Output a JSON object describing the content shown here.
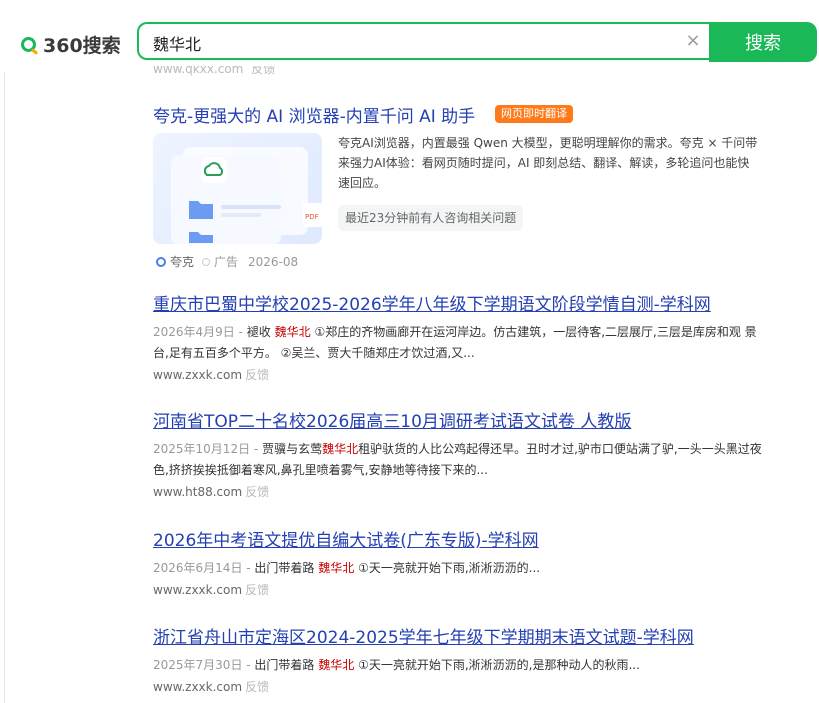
{
  "header": {
    "logo_text": "360搜索",
    "search_value": "魏华北",
    "clear_symbol": "×",
    "search_button": "搜索",
    "brand_color": "#19b955"
  },
  "cut_result": {
    "url": "www.qkxx.com",
    "feedback": "反馈"
  },
  "ad": {
    "title": "夸克-更强大的 AI 浏览器-内置千问 AI 助手",
    "badge": "网页即时翻译",
    "description": "夸克AI浏览器，内置最强 Qwen 大模型，更聪明理解你的需求。夸克 × 千问带来强力AI体验：看网页随时提问，AI 即刻总结、翻译、解读，多轮追问也能快速回应。",
    "chip": "最近23分钟前有人咨询相关问题",
    "source": "夸克",
    "ad_label": "广告",
    "date": "2026-08",
    "thumb_icons": [
      "cloud-icon",
      "folder-icon",
      "pdf-file-icon"
    ]
  },
  "results": [
    {
      "title": "重庆市巴蜀中学校2025-2026学年八年级下学期语文阶段学情自测-学科网",
      "date": "2026年4月9日",
      "sep": " - ",
      "pre": "褪收 ",
      "hl": "魏华北",
      "post": " ①郑庄的齐物画廊开在运河岸边。仿古建筑，一层待客,二层展厅,三层是库房和观 景台,足有五百多个平方。 ②吴兰、贾大千随郑庄才饮过酒,又...",
      "url": "www.zxxk.com",
      "feedback": "反馈"
    },
    {
      "title": "河南省TOP二十名校2026届高三10月调研考试语文试卷 人教版",
      "date": "2025年10月12日",
      "sep": " - ",
      "pre": "贾骥与玄莺",
      "hl": "魏华北",
      "post": "租驴驮货的人比公鸡起得还早。丑时才过,驴市口便站满了驴,一头一头黑过夜色,挤挤挨挨抵御着寒风,鼻孔里喷着雾气,安静地等待接下来的...",
      "url": "www.ht88.com",
      "feedback": "反馈"
    },
    {
      "title": "2026年中考语文提优自编大试卷(广东专版)-学科网",
      "date": "2026年6月14日",
      "sep": " - ",
      "pre": "出门带着路 ",
      "hl": "魏华北",
      "post": " ①天一亮就开始下雨,淅淅沥沥的...",
      "url": "www.zxxk.com",
      "feedback": "反馈"
    },
    {
      "title": "浙江省舟山市定海区2024-2025学年七年级下学期期末语文试题-学科网",
      "date": "2025年7月30日",
      "sep": " - ",
      "pre": "出门带着路 ",
      "hl": "魏华北",
      "post": " ①天一亮就开始下雨,淅淅沥沥的,是那种动人的秋雨...",
      "url": "www.zxxk.com",
      "feedback": "反馈"
    }
  ]
}
